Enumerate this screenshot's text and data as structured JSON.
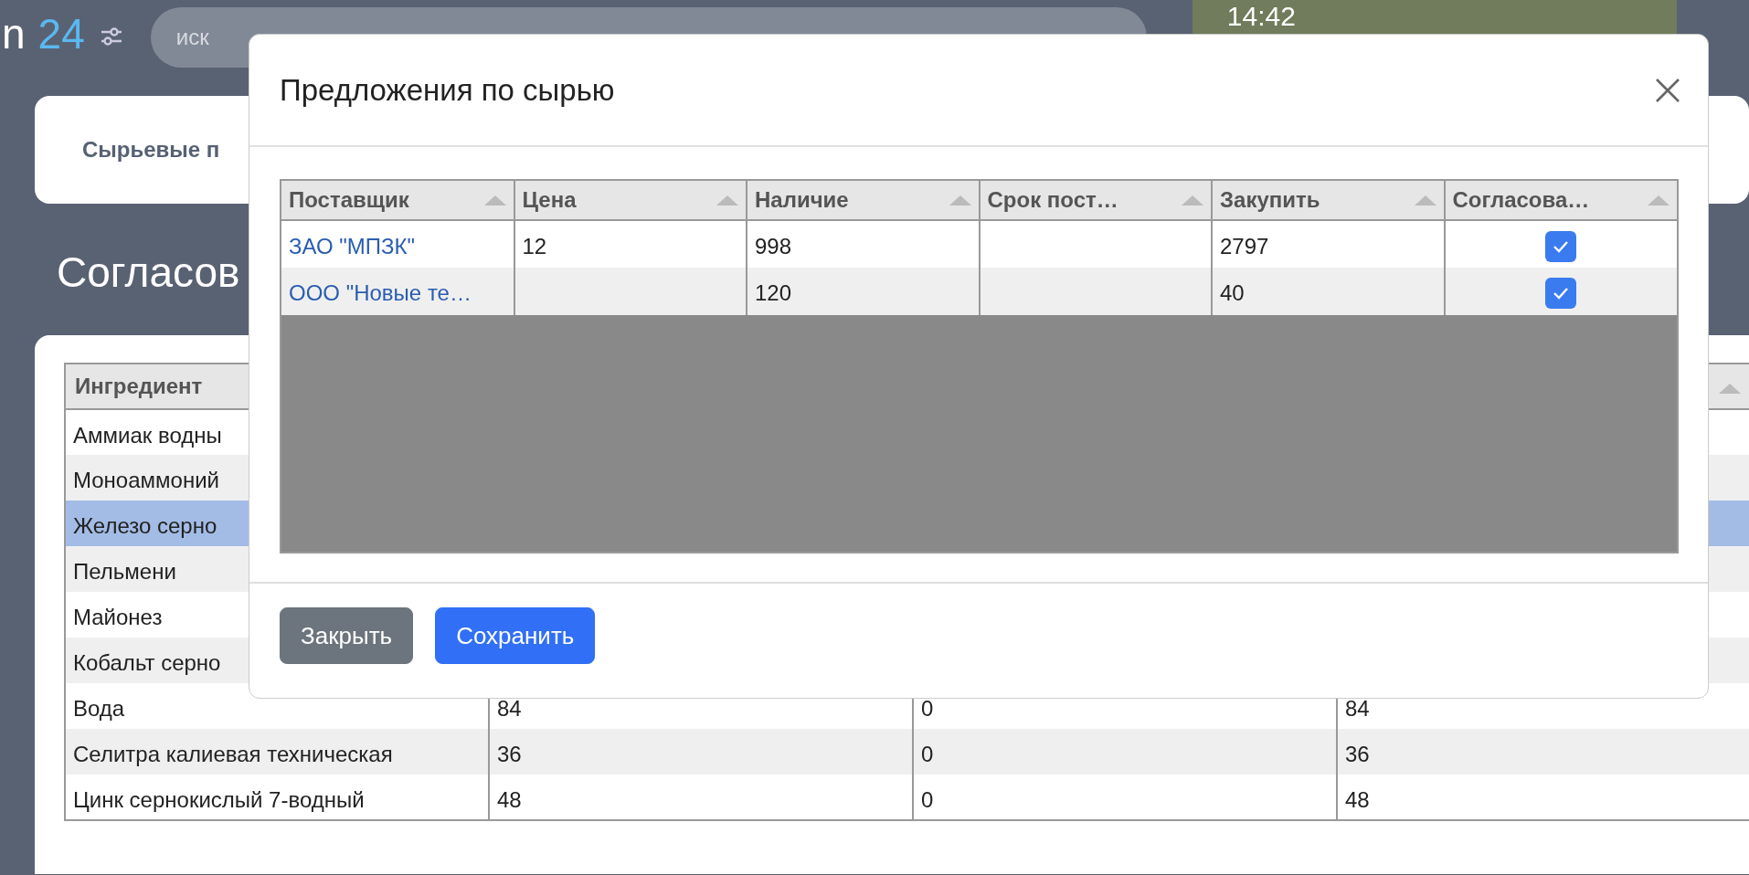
{
  "header": {
    "logo_letter": "n",
    "logo_number": "24",
    "search": {
      "placeholder": "иск"
    },
    "clock": "14:42"
  },
  "page": {
    "card_title": "Сырьевые п",
    "heading": "Согласов"
  },
  "table": {
    "columns": [
      {
        "label": "Ингредиент"
      }
    ],
    "rows": [
      {
        "ingredient": "Аммиак водны",
        "selected": false
      },
      {
        "ingredient": "Моноаммоний",
        "selected": false
      },
      {
        "ingredient": "Железо серно",
        "selected": true
      },
      {
        "ingredient": "Пельмени",
        "selected": false
      },
      {
        "ingredient": "Майонез",
        "selected": false
      },
      {
        "ingredient": "Кобальт серно",
        "selected": false
      },
      {
        "ingredient": "Вода",
        "values": [
          "84",
          "0",
          "84"
        ],
        "selected": false
      },
      {
        "ingredient": "Селитра калиевая техническая",
        "values": [
          "36",
          "0",
          "36"
        ],
        "selected": false
      },
      {
        "ingredient": "Цинк сернокислый 7-водный",
        "values": [
          "48",
          "0",
          "48"
        ],
        "selected": false
      }
    ]
  },
  "modal": {
    "title": "Предложения по сырью",
    "columns": [
      {
        "label": "Поставщик"
      },
      {
        "label": "Цена"
      },
      {
        "label": "Наличие"
      },
      {
        "label": "Срок пост…"
      },
      {
        "label": "Закупить"
      },
      {
        "label": "Согласова…"
      }
    ],
    "rows": [
      {
        "supplier": "ЗАО \"МПЗК\"",
        "price": "12",
        "stock": "998",
        "buy": "2797",
        "approved": true
      },
      {
        "supplier": "ООО \"Новые те…",
        "stock": "120",
        "buy": "40",
        "approved": true
      }
    ],
    "buttons": [
      {
        "label": "Закрыть",
        "kind": "secondary"
      },
      {
        "label": "Сохранить",
        "kind": "primary"
      }
    ]
  }
}
